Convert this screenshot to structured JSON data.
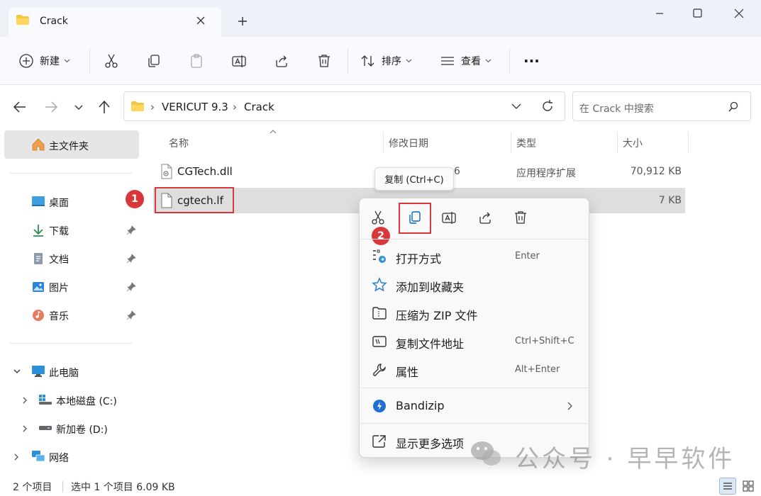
{
  "window": {
    "tab_title": "Crack",
    "new_tab_symbol": "+",
    "controls": [
      "minimize",
      "maximize",
      "close"
    ]
  },
  "toolbar": {
    "new_label": "新建",
    "sort_label": "排序",
    "view_label": "查看",
    "more_label": "···"
  },
  "address": {
    "segments": [
      "VERICUT 9.3",
      "Crack"
    ],
    "search_placeholder": "在 Crack 中搜索"
  },
  "sidebar": {
    "home": "主文件夹",
    "quick_access": [
      {
        "label": "桌面",
        "icon": "desktop-icon",
        "pinned": false
      },
      {
        "label": "下载",
        "icon": "download-icon",
        "pinned": true
      },
      {
        "label": "文档",
        "icon": "document-icon",
        "pinned": true
      },
      {
        "label": "图片",
        "icon": "picture-icon",
        "pinned": true
      },
      {
        "label": "音乐",
        "icon": "music-icon",
        "pinned": true
      }
    ],
    "this_pc": "此电脑",
    "drives": [
      {
        "label": "本地磁盘 (C:)"
      },
      {
        "label": "新加卷 (D:)"
      }
    ],
    "network": "网络"
  },
  "file_list": {
    "columns": [
      "名称",
      "修改日期",
      "类型",
      "大小"
    ],
    "rows": [
      {
        "name": "CGTech.dll",
        "date_fragment": "6",
        "type": "应用程序扩展",
        "size": "70,912 KB",
        "selected": false
      },
      {
        "name": "cgtech.lf",
        "date_fragment": "",
        "type": "",
        "size": "7 KB",
        "selected": true
      }
    ]
  },
  "annotations": {
    "badge1": "1",
    "badge2": "2"
  },
  "tooltip": {
    "text": "复制 (Ctrl+C)"
  },
  "context_menu": {
    "icon_row": [
      "cut-icon",
      "copy-icon",
      "rename-icon",
      "share-icon",
      "delete-icon"
    ],
    "items": [
      {
        "label": "打开方式",
        "shortcut": "Enter",
        "icon": "open-with-icon"
      },
      {
        "label": "添加到收藏夹",
        "shortcut": "",
        "icon": "star-icon"
      },
      {
        "label": "压缩为 ZIP 文件",
        "shortcut": "",
        "icon": "zip-icon"
      },
      {
        "label": "复制文件地址",
        "shortcut": "Ctrl+Shift+C",
        "icon": "copy-path-icon"
      },
      {
        "label": "属性",
        "shortcut": "Alt+Enter",
        "icon": "wrench-icon"
      },
      {
        "label": "Bandizip",
        "shortcut": "",
        "icon": "bandizip-icon",
        "submenu": true
      },
      {
        "label": "显示更多选项",
        "shortcut": "",
        "icon": "more-options-icon"
      }
    ]
  },
  "status": {
    "count": "2 个项目",
    "selection": "选中 1 个项目  6.09 KB"
  },
  "watermark": {
    "text": "公众号 · 早早软件"
  },
  "colors": {
    "accent": "#0067c0",
    "highlight_red": "#d9383a",
    "folder_yellow": "#f5c542",
    "selection_gray": "#dedede"
  }
}
